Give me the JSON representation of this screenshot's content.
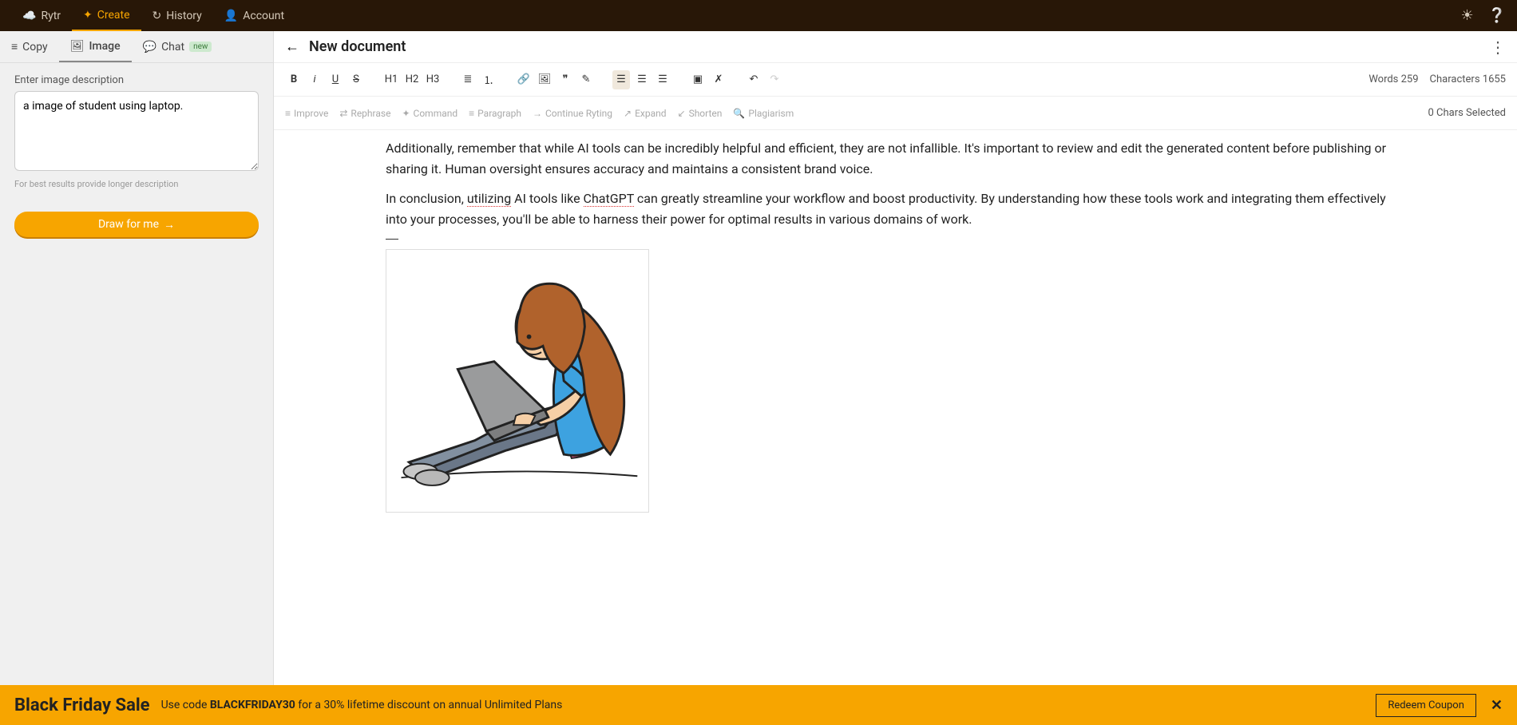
{
  "topbar": {
    "brand": "Rytr",
    "items": [
      "Create",
      "History",
      "Account"
    ]
  },
  "sidebar": {
    "tabs": {
      "copy": "Copy",
      "image": "Image",
      "chat": "Chat",
      "chat_badge": "new"
    },
    "desc_label": "Enter image description",
    "desc_value": "a image of student using laptop.",
    "desc_hint": "For best results provide longer description",
    "draw_label": "Draw for me"
  },
  "editor": {
    "title": "New document",
    "stats": {
      "words_label": "Words",
      "words": "259",
      "chars_label": "Characters",
      "chars": "1655"
    },
    "headings": [
      "H1",
      "H2",
      "H3"
    ],
    "ai": {
      "improve": "Improve",
      "rephrase": "Rephrase",
      "command": "Command",
      "paragraph": "Paragraph",
      "continue": "Continue Ryting",
      "expand": "Expand",
      "shorten": "Shorten",
      "plagiarism": "Plagiarism",
      "selected_label": "Chars Selected",
      "selected": "0"
    },
    "para1": "Additionally, remember that while AI tools can be incredibly helpful and efficient, they are not infallible. It's important to review and edit the generated content before publishing or sharing it. Human oversight ensures accuracy and maintains a consistent brand voice.",
    "para2_a": "In conclusion, ",
    "para2_u1": "utilizing",
    "para2_b": " AI tools like ",
    "para2_u2": "ChatGPT",
    "para2_c": " can greatly streamline your workflow and boost productivity. By understanding how these tools work and integrating them effectively into your processes, you'll be able to harness their power for optimal results in various domains of work."
  },
  "banner": {
    "title": "Black Friday Sale",
    "text_a": "Use code ",
    "code": "BLACKFRIDAY30",
    "text_b": " for a 30% lifetime discount on annual Unlimited Plans",
    "coupon": "Redeem Coupon"
  }
}
